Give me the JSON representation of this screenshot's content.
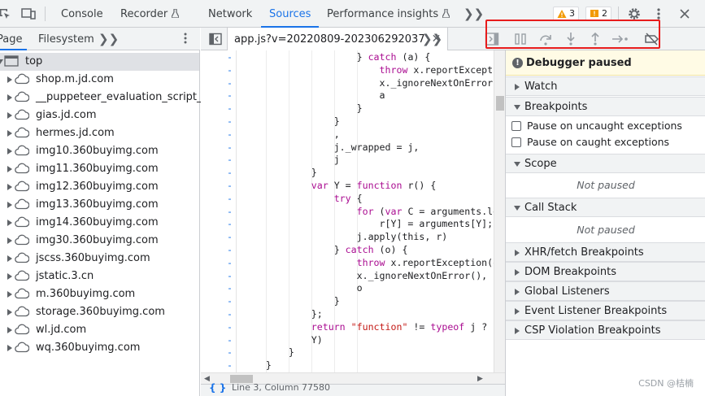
{
  "toolbar": {
    "tabs": [
      "Console",
      "Recorder",
      "Network",
      "Sources",
      "Performance insights"
    ],
    "active_tab": "Sources",
    "warnings_count": "3",
    "issues_count": "2",
    "icons": [
      "inspect-icon",
      "device-toolbar-icon",
      "more-tabs-icon",
      "settings-icon",
      "more-vert-icon",
      "close-icon"
    ]
  },
  "navigator": {
    "tabs": [
      "Page",
      "Filesystem"
    ],
    "tree": [
      {
        "label": "top",
        "level": 0,
        "expanded": true,
        "icon": "frame-icon"
      },
      {
        "label": "shop.m.jd.com",
        "level": 1,
        "icon": "cloud-icon"
      },
      {
        "label": "__puppeteer_evaluation_script__",
        "level": 1,
        "icon": "cloud-icon"
      },
      {
        "label": "gias.jd.com",
        "level": 1,
        "icon": "cloud-icon"
      },
      {
        "label": "hermes.jd.com",
        "level": 1,
        "icon": "cloud-icon"
      },
      {
        "label": "img10.360buyimg.com",
        "level": 1,
        "icon": "cloud-icon"
      },
      {
        "label": "img11.360buyimg.com",
        "level": 1,
        "icon": "cloud-icon"
      },
      {
        "label": "img12.360buyimg.com",
        "level": 1,
        "icon": "cloud-icon"
      },
      {
        "label": "img13.360buyimg.com",
        "level": 1,
        "icon": "cloud-icon"
      },
      {
        "label": "img14.360buyimg.com",
        "level": 1,
        "icon": "cloud-icon"
      },
      {
        "label": "img30.360buyimg.com",
        "level": 1,
        "icon": "cloud-icon"
      },
      {
        "label": "jscss.360buyimg.com",
        "level": 1,
        "icon": "cloud-icon"
      },
      {
        "label": "jstatic.3.cn",
        "level": 1,
        "icon": "cloud-icon"
      },
      {
        "label": "m.360buyimg.com",
        "level": 1,
        "icon": "cloud-icon"
      },
      {
        "label": "storage.360buyimg.com",
        "level": 1,
        "icon": "cloud-icon"
      },
      {
        "label": "wl.jd.com",
        "level": 1,
        "icon": "cloud-icon"
      },
      {
        "label": "wq.360buyimg.com",
        "level": 1,
        "icon": "cloud-icon"
      }
    ]
  },
  "editor": {
    "file_tab": "app.js?v=20220809-202306292037",
    "code_lines": [
      {
        "indent": 20,
        "tokens": [
          [
            "",
            "} "
          ],
          [
            "kw",
            "catch"
          ],
          [
            "",
            " (a) {"
          ]
        ]
      },
      {
        "indent": 24,
        "tokens": [
          [
            "kw",
            "throw"
          ],
          [
            "",
            " x.reportExcepti"
          ]
        ]
      },
      {
        "indent": 24,
        "tokens": [
          [
            "",
            "x._ignoreNextOnError("
          ]
        ]
      },
      {
        "indent": 24,
        "tokens": [
          [
            "",
            "a"
          ]
        ]
      },
      {
        "indent": 20,
        "tokens": [
          [
            "",
            "}"
          ]
        ]
      },
      {
        "indent": 16,
        "tokens": [
          [
            "",
            "}"
          ]
        ]
      },
      {
        "indent": 16,
        "tokens": [
          [
            "",
            ","
          ]
        ]
      },
      {
        "indent": 16,
        "tokens": [
          [
            "",
            "j._wrapped = j,"
          ]
        ]
      },
      {
        "indent": 16,
        "tokens": [
          [
            "",
            "j"
          ]
        ]
      },
      {
        "indent": 12,
        "tokens": [
          [
            "",
            "}"
          ]
        ]
      },
      {
        "indent": 12,
        "tokens": [
          [
            "kw",
            "var"
          ],
          [
            "",
            " Y = "
          ],
          [
            "kw",
            "function"
          ],
          [
            "",
            " r() {"
          ]
        ]
      },
      {
        "indent": 16,
        "tokens": [
          [
            "kw",
            "try"
          ],
          [
            "",
            " {"
          ]
        ]
      },
      {
        "indent": 20,
        "tokens": [
          [
            "kw",
            "for"
          ],
          [
            "",
            " ("
          ],
          [
            "kw",
            "var"
          ],
          [
            "",
            " C = arguments.le"
          ]
        ]
      },
      {
        "indent": 24,
        "tokens": [
          [
            "",
            "r[Y] = arguments[Y];"
          ]
        ]
      },
      {
        "indent": 20,
        "tokens": [
          [
            "",
            "j.apply(this, r)"
          ]
        ]
      },
      {
        "indent": 16,
        "tokens": [
          [
            "",
            "} "
          ],
          [
            "kw",
            "catch"
          ],
          [
            "",
            " (o) {"
          ]
        ]
      },
      {
        "indent": 20,
        "tokens": [
          [
            "kw",
            "throw"
          ],
          [
            "",
            " x.reportException(o"
          ]
        ]
      },
      {
        "indent": 20,
        "tokens": [
          [
            "",
            "x._ignoreNextOnError(),"
          ]
        ]
      },
      {
        "indent": 20,
        "tokens": [
          [
            "",
            "o"
          ]
        ]
      },
      {
        "indent": 16,
        "tokens": [
          [
            "",
            "}"
          ]
        ]
      },
      {
        "indent": 12,
        "tokens": [
          [
            "",
            "};"
          ]
        ]
      },
      {
        "indent": 12,
        "tokens": [
          [
            "kw",
            "return"
          ],
          [
            "",
            " "
          ],
          [
            "str",
            "\"function\""
          ],
          [
            "",
            " != "
          ],
          [
            "kw",
            "typeof"
          ],
          [
            "",
            " j ? j"
          ]
        ]
      },
      {
        "indent": 12,
        "tokens": [
          [
            "",
            "Y)"
          ]
        ]
      },
      {
        "indent": 8,
        "tokens": [
          [
            "",
            "}"
          ]
        ]
      },
      {
        "indent": 4,
        "tokens": [
          [
            "",
            "}"
          ]
        ]
      }
    ],
    "gutter_marker": "-",
    "status_text": "Line 3, Column 77580"
  },
  "debugger": {
    "buttons": [
      {
        "name": "pause-resume-button",
        "icon": "pause-icon"
      },
      {
        "name": "step-over-button",
        "icon": "step-over-icon"
      },
      {
        "name": "step-into-button",
        "icon": "step-into-icon"
      },
      {
        "name": "step-out-button",
        "icon": "step-out-icon"
      },
      {
        "name": "step-button",
        "icon": "step-icon"
      },
      {
        "name": "deactivate-breakpoints-button",
        "icon": "breakpoints-off-icon"
      }
    ],
    "highlight_color": "#e81c1c",
    "status": "Debugger paused",
    "sections": {
      "watch": "Watch",
      "breakpoints": "Breakpoints",
      "pause_uncaught": "Pause on uncaught exceptions",
      "pause_caught": "Pause on caught exceptions",
      "scope": "Scope",
      "scope_empty": "Not paused",
      "call_stack": "Call Stack",
      "call_stack_empty": "Not paused",
      "xhr": "XHR/fetch Breakpoints",
      "dom": "DOM Breakpoints",
      "global": "Global Listeners",
      "event": "Event Listener Breakpoints",
      "csp": "CSP Violation Breakpoints"
    }
  },
  "watermark": "CSDN @桔楠",
  "colors": {
    "accent": "#1a73e8",
    "keyword": "#aa0d91",
    "string": "#c41a16"
  }
}
